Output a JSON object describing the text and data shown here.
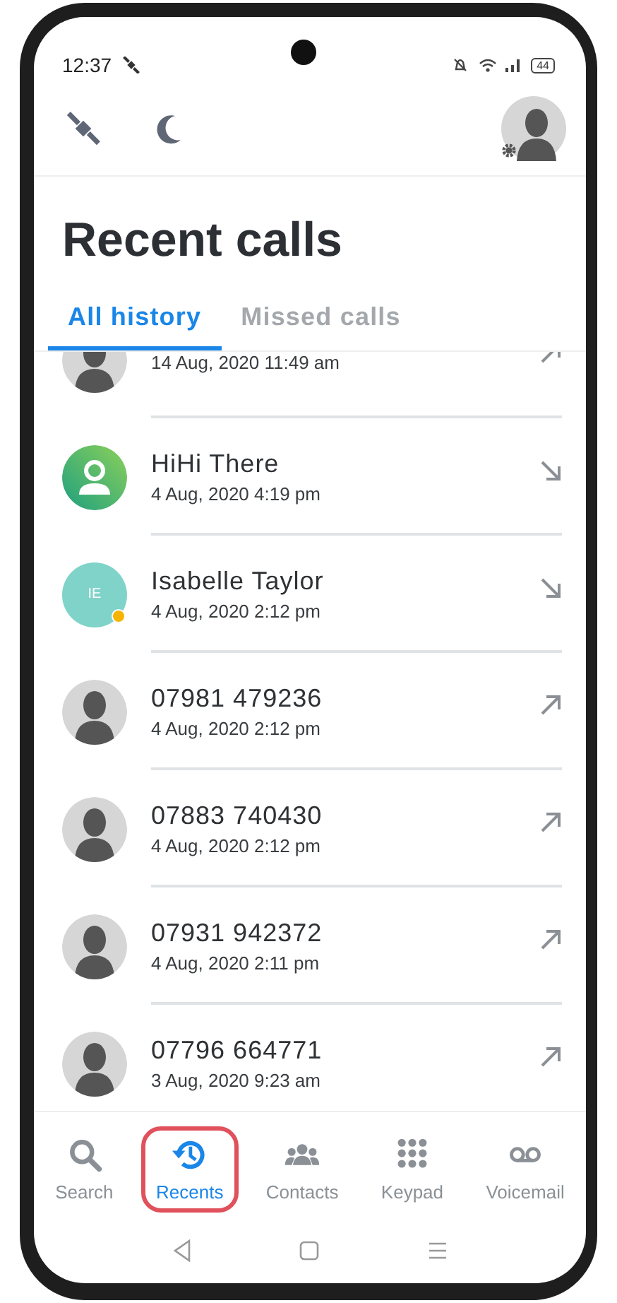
{
  "status_bar": {
    "time": "12:37",
    "battery": "44"
  },
  "title": "Recent calls",
  "tabs": [
    {
      "label": "All history",
      "selected": true
    },
    {
      "label": "Missed calls",
      "selected": false
    }
  ],
  "calls": [
    {
      "date": "14 Aug, 2020 11:49 am",
      "kind": "silhouette",
      "incoming": false
    },
    {
      "name": "HiHi There",
      "date": "4 Aug, 2020 4:19 pm",
      "kind": "contact",
      "incoming": true
    },
    {
      "name": "Isabelle Taylor",
      "date": "4 Aug, 2020 2:12 pm",
      "kind": "initials",
      "initials": "IE",
      "color": "#7fd3c9",
      "presence": true,
      "incoming": true
    },
    {
      "name": "07981 479236",
      "date": "4 Aug, 2020 2:12 pm",
      "kind": "silhouette",
      "incoming": false
    },
    {
      "name": "07883 740430",
      "date": "4 Aug, 2020 2:12 pm",
      "kind": "silhouette",
      "incoming": false
    },
    {
      "name": "07931 942372",
      "date": "4 Aug, 2020 2:11 pm",
      "kind": "silhouette",
      "incoming": false
    },
    {
      "name": "07796 664771",
      "date": "3 Aug, 2020 9:23 am",
      "kind": "silhouette",
      "incoming": false
    }
  ],
  "nav": [
    {
      "label": "Search",
      "selected": false,
      "highlighted": false
    },
    {
      "label": "Recents",
      "selected": true,
      "highlighted": true
    },
    {
      "label": "Contacts",
      "selected": false,
      "highlighted": false
    },
    {
      "label": "Keypad",
      "selected": false,
      "highlighted": false
    },
    {
      "label": "Voicemail",
      "selected": false,
      "highlighted": false
    }
  ]
}
